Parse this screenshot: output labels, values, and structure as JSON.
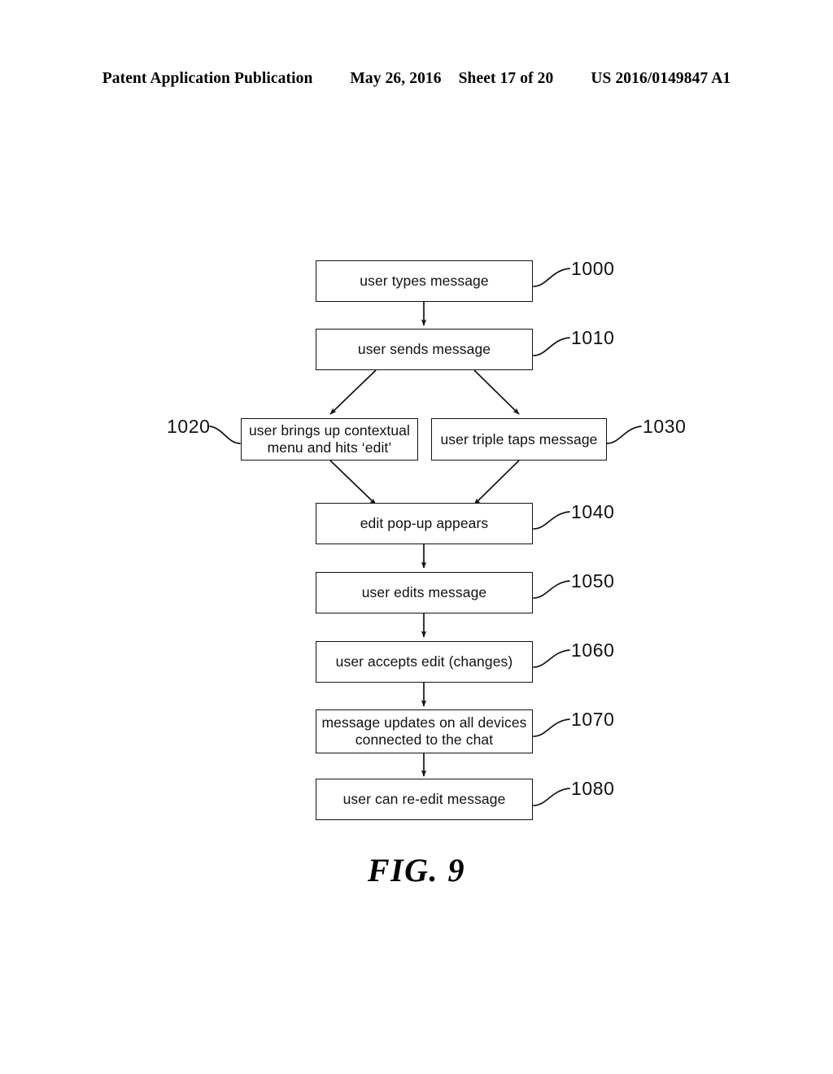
{
  "header": {
    "publication": "Patent Application Publication",
    "date": "May 26, 2016",
    "sheet": "Sheet 17 of 20",
    "patent_number": "US 2016/0149847 A1"
  },
  "figure": {
    "caption": "FIG. 9"
  },
  "flowchart": {
    "nodes": [
      {
        "ref": "1000",
        "label": "user types message"
      },
      {
        "ref": "1010",
        "label": "user sends message"
      },
      {
        "ref": "1020",
        "label": "user brings up contextual\nmenu and hits ‘edit’"
      },
      {
        "ref": "1030",
        "label": "user triple taps message"
      },
      {
        "ref": "1040",
        "label": "edit pop-up appears"
      },
      {
        "ref": "1050",
        "label": "user edits message"
      },
      {
        "ref": "1060",
        "label": "user accepts edit (changes)"
      },
      {
        "ref": "1070",
        "label": "message updates on all devices\nconnected to the chat"
      },
      {
        "ref": "1080",
        "label": "user can re-edit message"
      }
    ],
    "colors": {
      "line": "#121212",
      "box_fill": "#ffffff",
      "text": "#111111"
    }
  }
}
